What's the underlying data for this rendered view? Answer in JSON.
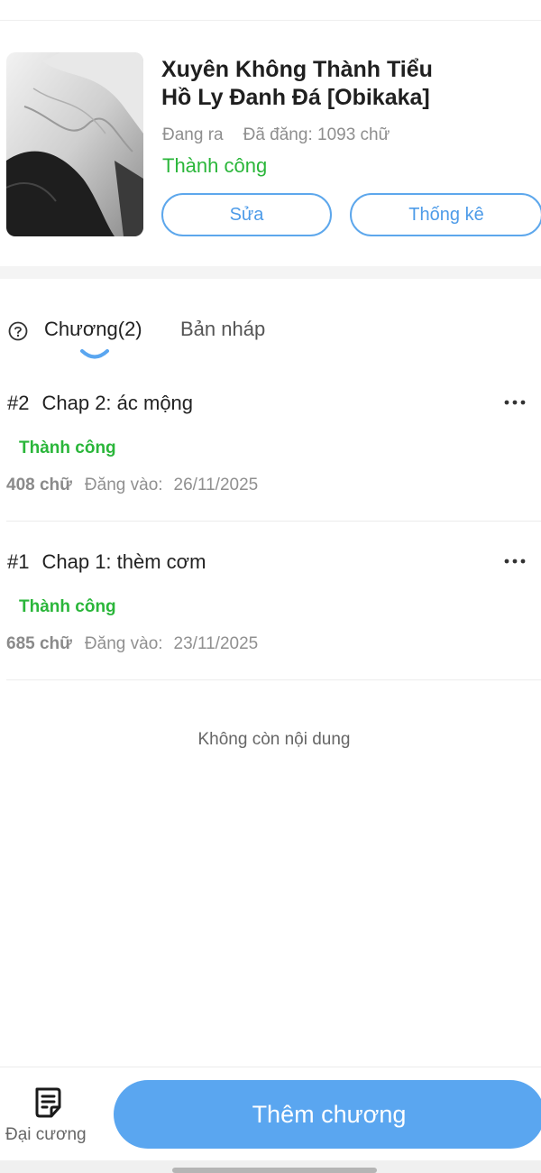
{
  "book": {
    "title": "Xuyên Không Thành Tiểu Hồ Ly Đanh Đá [Obikaka]",
    "publish_state": "Đang ra",
    "word_count_label": "Đã đăng: 1093 chữ",
    "review_status": "Thành công",
    "edit_label": "Sửa",
    "stats_label": "Thống kê"
  },
  "tabs": {
    "chapters_label": "Chương(2)",
    "drafts_label": "Bản nháp"
  },
  "chapters": [
    {
      "number": "#2",
      "title": "Chap 2: ác mộng",
      "status": "Thành công",
      "words": "408 chữ",
      "date_label": "Đăng vào:",
      "date": "26/11/2025"
    },
    {
      "number": "#1",
      "title": "Chap 1: thèm cơm",
      "status": "Thành công",
      "words": "685 chữ",
      "date_label": "Đăng vào:",
      "date": "23/11/2025"
    }
  ],
  "list_end_text": "Không còn nội dung",
  "bottom_bar": {
    "outline_label": "Đại cương",
    "add_chapter_label": "Thêm chương"
  },
  "colors": {
    "accent": "#5aa6f0",
    "success": "#2ab63a"
  }
}
